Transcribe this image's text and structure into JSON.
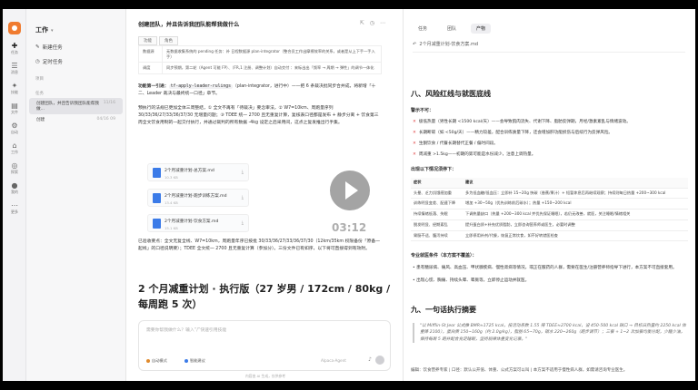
{
  "rail": {
    "items": [
      {
        "icon": "✚",
        "label": "任务"
      },
      {
        "icon": "☰",
        "label": "消息"
      },
      {
        "icon": "✦",
        "label": "技能"
      },
      {
        "icon": "▤",
        "label": "文件"
      },
      {
        "icon": "⚙",
        "label": "自动"
      },
      {
        "icon": "⌂",
        "label": "工作"
      },
      {
        "icon": "◎",
        "label": "探索"
      },
      {
        "icon": "●",
        "label": "我的"
      },
      {
        "icon": "⋯",
        "label": "更多"
      }
    ]
  },
  "sidebar": {
    "title": "工作",
    "new_task": "新建任务",
    "scheduled": "定时任务",
    "section": "项目",
    "section2": "任务",
    "rows": [
      {
        "label": "创建团队，并且告诉我团队能帮我做...",
        "time": "11/16"
      },
      {
        "label": "创建",
        "time": "04/16 09"
      }
    ]
  },
  "chat": {
    "title": "创建团队，并且告诉我团队能帮我做什么",
    "table_tabs": [
      "功能",
      "角色"
    ],
    "table_rows": [
      [
        "数据源",
        "无数据收集系统的 pending 任务：补 日程数据源 plan-integrator（整合员工作出摩擦效率的关系，或者是从上下手一手入手）"
      ],
      [
        "调度",
        "同步预期，第二轮（Agent 可能 FP）、（FR,1 注册、调整计划）自动交付 ：来标出出「频率 → 周期 → 弹性」的调节一体化"
      ]
    ],
    "para1": "功能第一引进：",
    "para1_code": "tf-apply-leader-rulings",
    "para1_rest": "（plan-integrator，进行中）——把 6 条裁决批同步合并成，将新增「十二、Leader 裁决与最终统一口径」章节。",
    "para2": "预执行的法规已更加全体三周整结，① 全文不再有「待裁决」要念审法，② W7=10km、周跑量序列 30/33/36/27/33/36/37/30 无增量问题；③ TDEE 统一 2700 且无重复计算，复核表口径都是发布 + 静步分离 + 饮食第三周全文饮食用制的一起交付执行，并通过裁判的所有数据 -4kg 设定之后采用间，这点之复发推出行手集。",
    "files": [
      {
        "name": "2个月减重计划-总方案.md",
        "size": "10.3 KB"
      },
      {
        "name": "2个月减重计划-跑步训练方案.md",
        "size": "13.4 KB"
      },
      {
        "name": "2个月减重计划-饮食方案.md",
        "size": "15.1 KB"
      }
    ],
    "para3": "已验收要点：全文无复全线、W7=10km，周跑量年序已按批 30/33/36/27/33/36/37/30（12km/35km 权限备份「原备一起线」的口径说明要）；TDEE 全文统一 2700 且无重复计算（参加分）。三份文件已有如序，以下将可直接得到有效附。",
    "heading": "2 个月减重计划 · 执行版（27 岁男 / 172cm / 80kg / 每周跑 5 次）",
    "input_placeholder": "需要你帮我做什么？输入“/”快速引用技能",
    "pill1": "自动模式",
    "pill2": "智能建议",
    "pill3": "Alpaca-Agent",
    "footnote": "内容由 AI 生成，仅供参考"
  },
  "player": {
    "timer": "03:12"
  },
  "right": {
    "tabs": [
      "任务",
      "团队",
      "产物"
    ],
    "file": "2个月减重计划-饮食方案.md",
    "h1": "八、风险红线与就医底线",
    "sub1": "警示不可：",
    "bullets": [
      "极低热量（男性长期 <1500 kcal/天）——会导致肌肉流失、代谢下降、脂肪反弹期，月经/激素紊乱与情绪波动。",
      "长期断碳（如 <50g/天）——精力较差，配合训练质量下降，还会增加肝功能损伤与后续行为反弹风险。",
      "生酮饮食 / 代餐长期替代正餐 / 偏时间段。",
      "周减重 >1.5kg——初期的第可能是水份减少，注意上调热量。"
    ],
    "sub2": "出现以下情况须停下：",
    "table_head": [
      "症状",
      "建议"
    ],
    "table_rows": [
      [
        "头晕、乏力饥饿感加重",
        "多为低血糖/低血压：立即补 15~20g 快碳（香蕉/果汁）+ 短暂休息后再继续观察；持续则每日热量 +200~300 kcal"
      ],
      [
        "训练明显变差、配速下降",
        "增加 +30~50g（优先训练前后碳水）；热量 +150~200 kcal"
      ],
      [
        "持续情绪低落、失眠",
        "下调热量缺口（热量 +200~300 kcal 并优先保证睡眠），若仍无改善，就医，关注睡眠/情绪相关"
      ],
      [
        "脱发明显、经期紊乱",
        "提升蛋白质+补充优质脂肪，立即咨询营养师或医生，必要时调整"
      ],
      [
        "胃肠不适、腹泻持续",
        "立即停用补剂/代餐，恢复正常饮食，如不好转就医检查"
      ]
    ],
    "sub3": "专业就医条件（本方案不覆盖）：",
    "bullets2": [
      "患有糖尿病、痛风、高血压、甲状腺疾病、慢性肾病等情况，或正在服药的人群，需要在医生/注册营养师指导下进行，本方案不可直接套用。",
      "出现心慌、胸痛、持续头晕、晕厥等，立即停止运动并就医。"
    ],
    "h2": "九、一句话执行摘要",
    "quote": "\"以 Mifflin-St Jeor 公式推 BMR≈1725 kcal，按活动系数 1.55 得 TDEE≈2700 kcal，设 450-500 kcal 缺口 → 目标日热量约 2250 kcal 体重降 2100），蛋白质 150~160g（约 2.0g/kg），脂肪 65~70g，碳水 220~260g（跑步调节）；三餐 + 1~2 次加餐均衡分配，少糖少油，保持每周 5 跑并配合充足睡眠，坚持规律体重变化记录。\"",
    "footer": "编辑：饮食营养专家 | 口径：默认公开值、体重、公式方案可以叫 | 本方案不适用于慢性病人群，如需请咨询专业医生。"
  }
}
